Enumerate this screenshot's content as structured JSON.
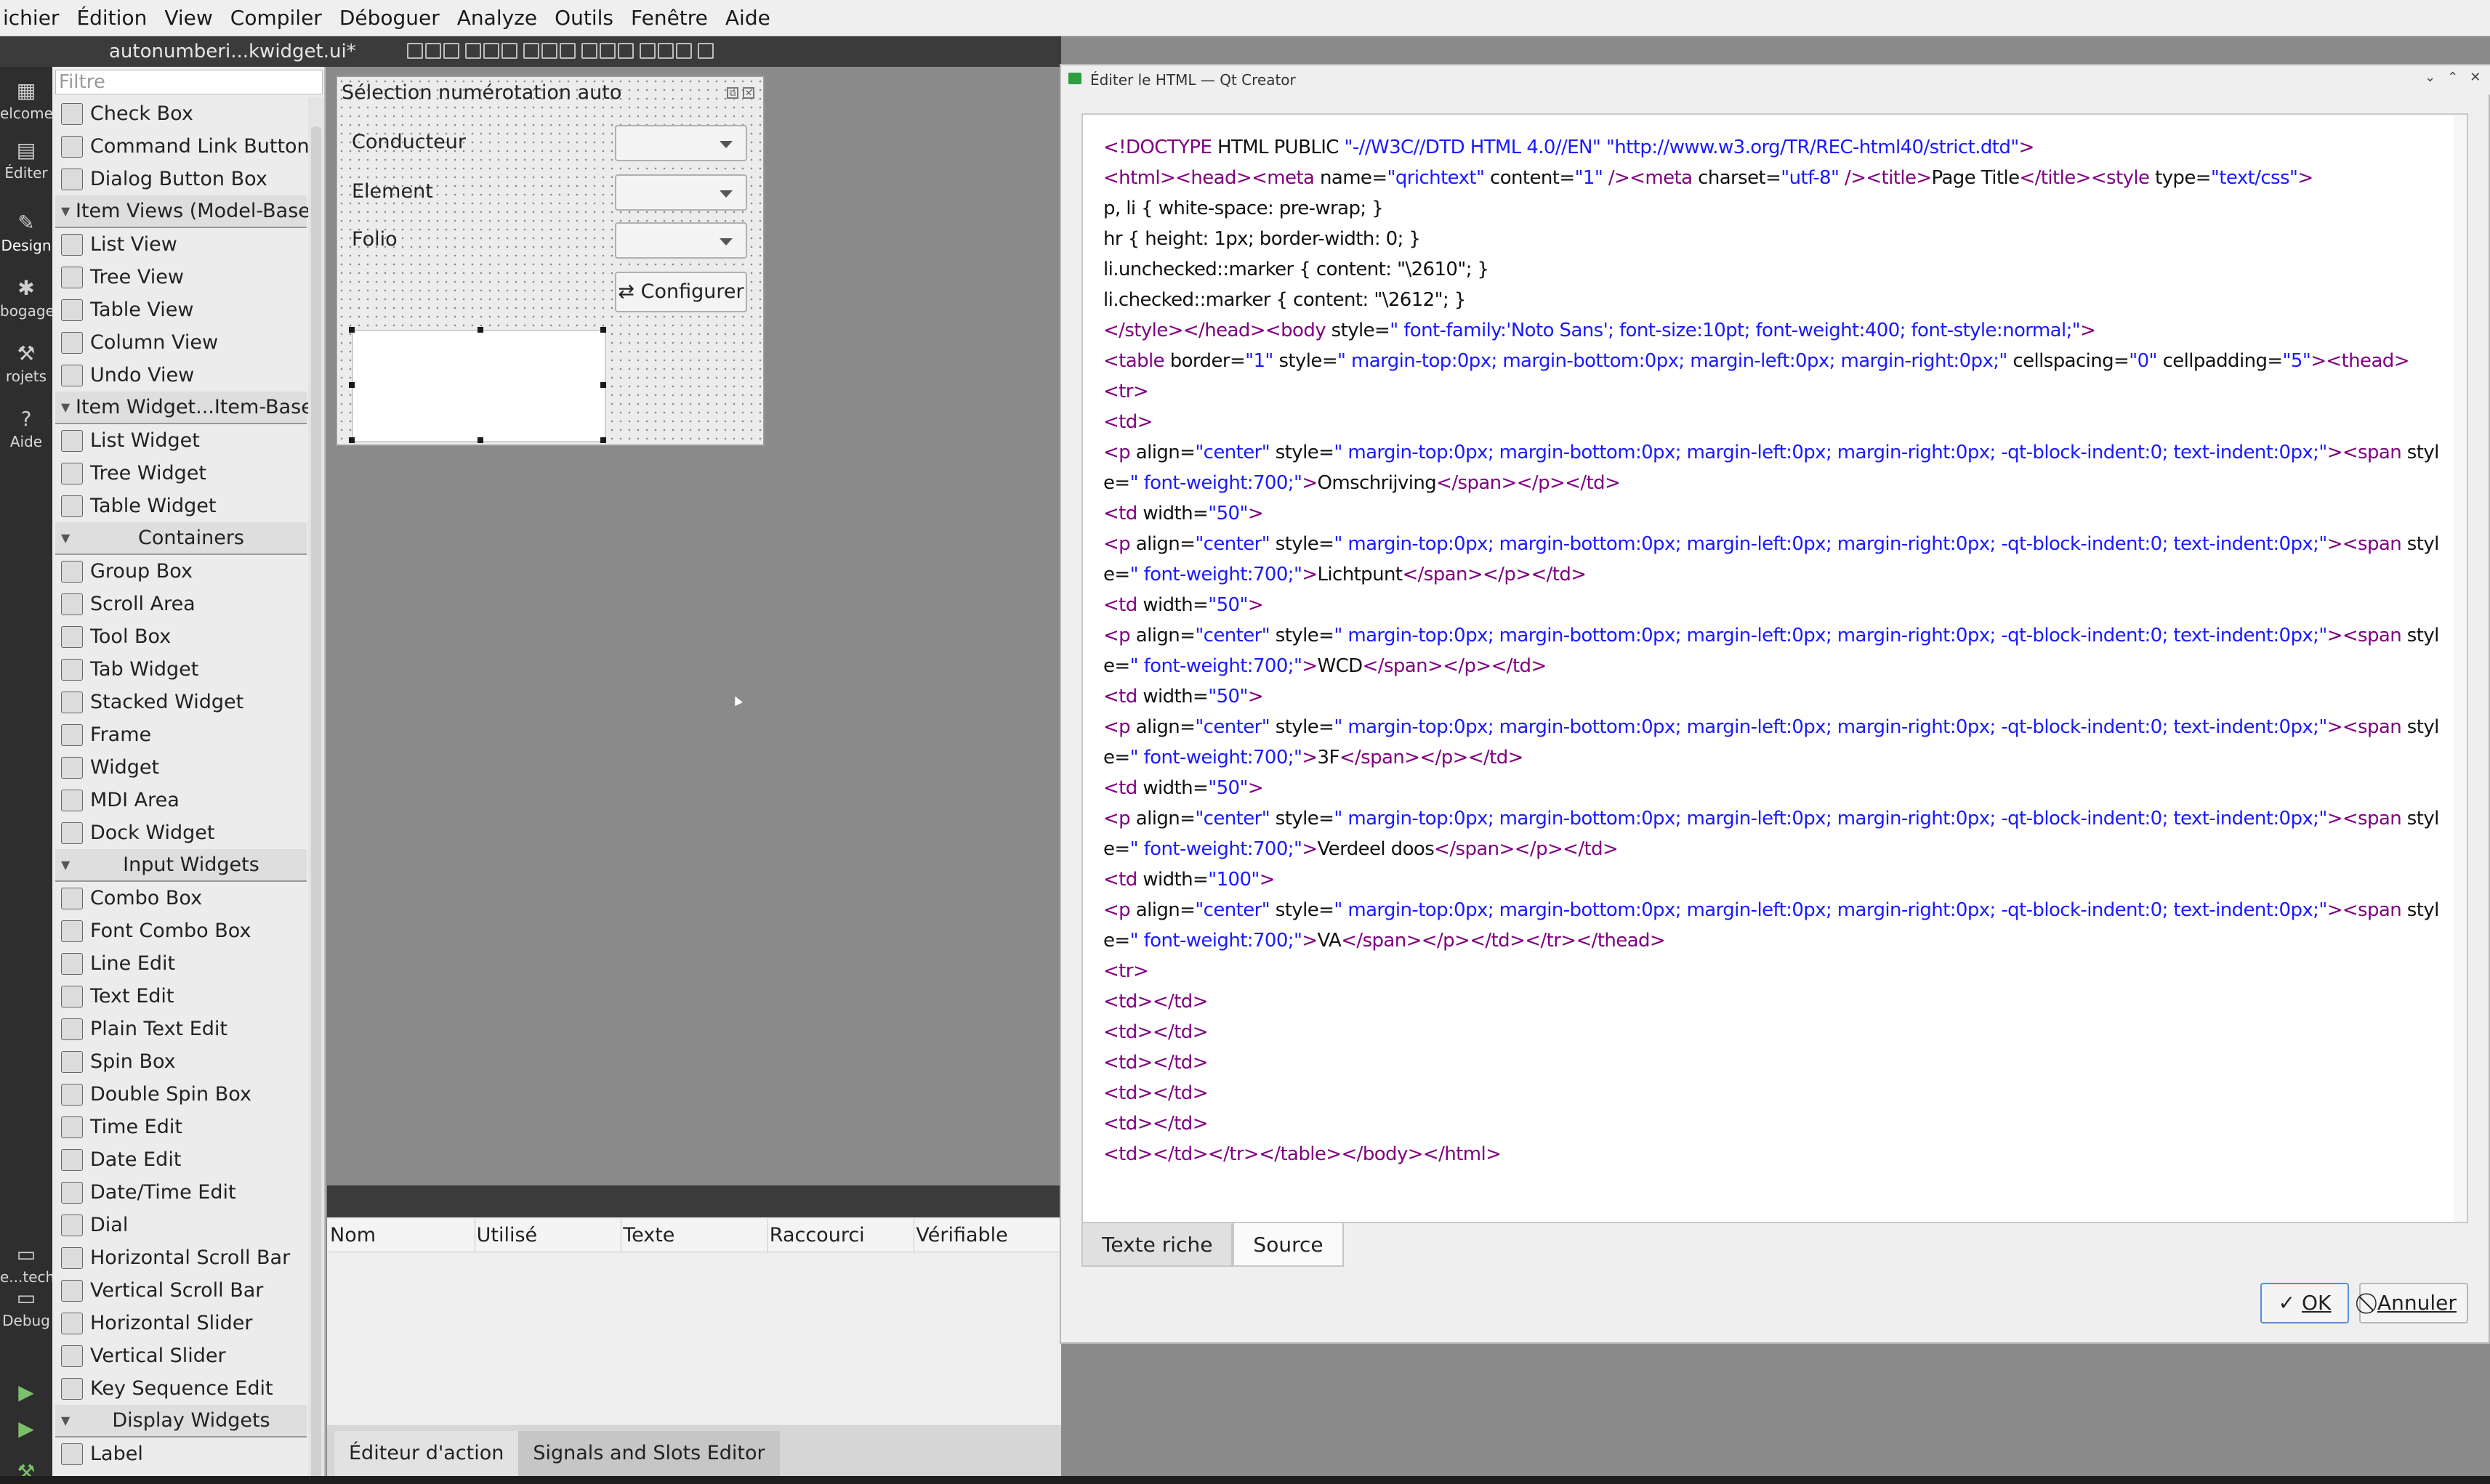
{
  "menubar": {
    "items": [
      "ichier",
      "Édition",
      "View",
      "Compiler",
      "Déboguer",
      "Analyze",
      "Outils",
      "Fenêtre",
      "Aide"
    ]
  },
  "doc_toolbar": {
    "file_name": "autonumberi...kwidget.ui*",
    "icons": [
      "layout-icon",
      "break-layout-icon",
      "grid-icon"
    ]
  },
  "modes": [
    {
      "label": "elcome",
      "icon": "grid-icon"
    },
    {
      "label": "Éditer",
      "icon": "edit-icon"
    },
    {
      "label": "Design",
      "icon": "pencil-icon"
    },
    {
      "label": "bogage",
      "icon": "bug-icon"
    },
    {
      "label": "rojets",
      "icon": "wrench-icon"
    },
    {
      "label": "Aide",
      "icon": "help-icon"
    },
    {
      "label": "e...tech",
      "icon": "monitor-icon"
    },
    {
      "label": "Debug",
      "icon": "monitor-icon"
    }
  ],
  "widgetbox": {
    "filter_placeholder": "Filtre",
    "entries": [
      {
        "type": "item",
        "label": "Check Box"
      },
      {
        "type": "item",
        "label": "Command Link Button"
      },
      {
        "type": "item",
        "label": "Dialog Button Box"
      },
      {
        "type": "cat",
        "label": "Item Views (Model-Based)",
        "center": false
      },
      {
        "type": "item",
        "label": "List View"
      },
      {
        "type": "item",
        "label": "Tree View"
      },
      {
        "type": "item",
        "label": "Table View"
      },
      {
        "type": "item",
        "label": "Column View"
      },
      {
        "type": "item",
        "label": "Undo View"
      },
      {
        "type": "cat",
        "label": "Item Widget...Item-Based)",
        "center": false
      },
      {
        "type": "item",
        "label": "List Widget"
      },
      {
        "type": "item",
        "label": "Tree Widget"
      },
      {
        "type": "item",
        "label": "Table Widget"
      },
      {
        "type": "cat",
        "label": "Containers",
        "center": true
      },
      {
        "type": "item",
        "label": "Group Box"
      },
      {
        "type": "item",
        "label": "Scroll Area"
      },
      {
        "type": "item",
        "label": "Tool Box"
      },
      {
        "type": "item",
        "label": "Tab Widget"
      },
      {
        "type": "item",
        "label": "Stacked Widget"
      },
      {
        "type": "item",
        "label": "Frame"
      },
      {
        "type": "item",
        "label": "Widget"
      },
      {
        "type": "item",
        "label": "MDI Area"
      },
      {
        "type": "item",
        "label": "Dock Widget"
      },
      {
        "type": "cat",
        "label": "Input Widgets",
        "center": true
      },
      {
        "type": "item",
        "label": "Combo Box"
      },
      {
        "type": "item",
        "label": "Font Combo Box"
      },
      {
        "type": "item",
        "label": "Line Edit"
      },
      {
        "type": "item",
        "label": "Text Edit"
      },
      {
        "type": "item",
        "label": "Plain Text Edit"
      },
      {
        "type": "item",
        "label": "Spin Box"
      },
      {
        "type": "item",
        "label": "Double Spin Box"
      },
      {
        "type": "item",
        "label": "Time Edit"
      },
      {
        "type": "item",
        "label": "Date Edit"
      },
      {
        "type": "item",
        "label": "Date/Time Edit"
      },
      {
        "type": "item",
        "label": "Dial"
      },
      {
        "type": "item",
        "label": "Horizontal Scroll Bar"
      },
      {
        "type": "item",
        "label": "Vertical Scroll Bar"
      },
      {
        "type": "item",
        "label": "Horizontal Slider"
      },
      {
        "type": "item",
        "label": "Vertical Slider"
      },
      {
        "type": "item",
        "label": "Key Sequence Edit"
      },
      {
        "type": "cat",
        "label": "Display Widgets",
        "center": true
      },
      {
        "type": "item",
        "label": "Label"
      }
    ]
  },
  "form": {
    "title": "Sélection numérotation auto",
    "labels": [
      "Conducteur",
      "Element",
      "Folio"
    ],
    "configure_button": "⇄ Configurer"
  },
  "action_editor": {
    "columns": [
      "Nom",
      "Utilisé",
      "Texte",
      "Raccourci",
      "Vérifiable"
    ],
    "tabs": [
      "Éditeur d'action",
      "Signals and Slots Editor"
    ]
  },
  "dialog": {
    "title": "Éditer le HTML — Qt Creator",
    "title_buttons": [
      "⌄",
      "⌃",
      "✕"
    ],
    "tabs": [
      "Texte riche",
      "Source"
    ],
    "ok_label": "OK",
    "cancel_label": "Annuler",
    "colors": {
      "tag": "#800080",
      "attr_value": "#1a1aff"
    },
    "code_lines": [
      [
        [
          "t",
          "<!DOCTYPE "
        ],
        [
          "a",
          "HTML PUBLIC "
        ],
        [
          "v",
          "\"-//W3C//DTD HTML 4.0//EN\" \"http://www.w3.org/TR/REC-html40/strict.dtd\""
        ],
        [
          "t",
          ">"
        ]
      ],
      [
        [
          "t",
          "<html><head><meta "
        ],
        [
          "a",
          "name"
        ],
        [
          "a",
          "="
        ],
        [
          "v",
          "\"qrichtext\" "
        ],
        [
          "a",
          "content"
        ],
        [
          "a",
          "="
        ],
        [
          "v",
          "\"1\" "
        ],
        [
          "t",
          "/><meta "
        ],
        [
          "a",
          "charset"
        ],
        [
          "a",
          "="
        ],
        [
          "v",
          "\"utf-8\" "
        ],
        [
          "t",
          "/><title>"
        ],
        [
          "a",
          "Page Title"
        ],
        [
          "t",
          "</title><style "
        ],
        [
          "a",
          "type"
        ],
        [
          "a",
          "="
        ],
        [
          "v",
          "\"text/css\""
        ],
        [
          "t",
          ">"
        ]
      ],
      [
        [
          "a",
          "p, li { white-space: pre-wrap; }"
        ]
      ],
      [
        [
          "a",
          "hr { height: 1px; border-width: 0; }"
        ]
      ],
      [
        [
          "a",
          "li.unchecked::marker { content: \"\\2610\"; }"
        ]
      ],
      [
        [
          "a",
          "li.checked::marker { content: \"\\2612\"; }"
        ]
      ],
      [
        [
          "t",
          "</style></head><body "
        ],
        [
          "a",
          "style"
        ],
        [
          "a",
          "="
        ],
        [
          "v",
          "\" font-family:'Noto Sans'; font-size:10pt; font-weight:400; font-style:normal;\""
        ],
        [
          "t",
          ">"
        ]
      ],
      [
        [
          "t",
          "<table "
        ],
        [
          "a",
          "border"
        ],
        [
          "a",
          "="
        ],
        [
          "v",
          "\"1\" "
        ],
        [
          "a",
          "style"
        ],
        [
          "a",
          "="
        ],
        [
          "v",
          "\" margin-top:0px; margin-bottom:0px; margin-left:0px; margin-right:0px;\" "
        ],
        [
          "a",
          "cellspacing"
        ],
        [
          "a",
          "="
        ],
        [
          "v",
          "\"0\" "
        ],
        [
          "a",
          "cellpadding"
        ],
        [
          "a",
          "="
        ],
        [
          "v",
          "\"5\""
        ],
        [
          "t",
          "><thead>"
        ]
      ],
      [
        [
          "t",
          "<tr>"
        ]
      ],
      [
        [
          "t",
          "<td>"
        ]
      ],
      [
        [
          "t",
          "<p "
        ],
        [
          "a",
          "align"
        ],
        [
          "a",
          "="
        ],
        [
          "v",
          "\"center\" "
        ],
        [
          "a",
          "style"
        ],
        [
          "a",
          "="
        ],
        [
          "v",
          "\" margin-top:0px; margin-bottom:0px; margin-left:0px; margin-right:0px; -qt-block-indent:0; text-indent:0px;\""
        ],
        [
          "t",
          "><span "
        ],
        [
          "a",
          "style"
        ],
        [
          "a",
          "="
        ],
        [
          "v",
          "\" font-weight:700;\""
        ],
        [
          "t",
          ">"
        ],
        [
          "a",
          "Omschrijving"
        ],
        [
          "t",
          "</span></p></td>"
        ]
      ],
      [
        [
          "t",
          "<td "
        ],
        [
          "a",
          "width"
        ],
        [
          "a",
          "="
        ],
        [
          "v",
          "\"50\""
        ],
        [
          "t",
          ">"
        ]
      ],
      [
        [
          "t",
          "<p "
        ],
        [
          "a",
          "align"
        ],
        [
          "a",
          "="
        ],
        [
          "v",
          "\"center\" "
        ],
        [
          "a",
          "style"
        ],
        [
          "a",
          "="
        ],
        [
          "v",
          "\" margin-top:0px; margin-bottom:0px; margin-left:0px; margin-right:0px; -qt-block-indent:0; text-indent:0px;\""
        ],
        [
          "t",
          "><span "
        ],
        [
          "a",
          "style"
        ],
        [
          "a",
          "="
        ],
        [
          "v",
          "\" font-weight:700;\""
        ],
        [
          "t",
          ">"
        ],
        [
          "a",
          "Lichtpunt"
        ],
        [
          "t",
          "</span></p></td>"
        ]
      ],
      [
        [
          "t",
          "<td "
        ],
        [
          "a",
          "width"
        ],
        [
          "a",
          "="
        ],
        [
          "v",
          "\"50\""
        ],
        [
          "t",
          ">"
        ]
      ],
      [
        [
          "t",
          "<p "
        ],
        [
          "a",
          "align"
        ],
        [
          "a",
          "="
        ],
        [
          "v",
          "\"center\" "
        ],
        [
          "a",
          "style"
        ],
        [
          "a",
          "="
        ],
        [
          "v",
          "\" margin-top:0px; margin-bottom:0px; margin-left:0px; margin-right:0px; -qt-block-indent:0; text-indent:0px;\""
        ],
        [
          "t",
          "><span "
        ],
        [
          "a",
          "style"
        ],
        [
          "a",
          "="
        ],
        [
          "v",
          "\" font-weight:700;\""
        ],
        [
          "t",
          ">"
        ],
        [
          "a",
          "WCD"
        ],
        [
          "t",
          "</span></p></td>"
        ]
      ],
      [
        [
          "t",
          "<td "
        ],
        [
          "a",
          "width"
        ],
        [
          "a",
          "="
        ],
        [
          "v",
          "\"50\""
        ],
        [
          "t",
          ">"
        ]
      ],
      [
        [
          "t",
          "<p "
        ],
        [
          "a",
          "align"
        ],
        [
          "a",
          "="
        ],
        [
          "v",
          "\"center\" "
        ],
        [
          "a",
          "style"
        ],
        [
          "a",
          "="
        ],
        [
          "v",
          "\" margin-top:0px; margin-bottom:0px; margin-left:0px; margin-right:0px; -qt-block-indent:0; text-indent:0px;\""
        ],
        [
          "t",
          "><span "
        ],
        [
          "a",
          "style"
        ],
        [
          "a",
          "="
        ],
        [
          "v",
          "\" font-weight:700;\""
        ],
        [
          "t",
          ">"
        ],
        [
          "a",
          "3F"
        ],
        [
          "t",
          "</span></p></td>"
        ]
      ],
      [
        [
          "t",
          "<td "
        ],
        [
          "a",
          "width"
        ],
        [
          "a",
          "="
        ],
        [
          "v",
          "\"50\""
        ],
        [
          "t",
          ">"
        ]
      ],
      [
        [
          "t",
          "<p "
        ],
        [
          "a",
          "align"
        ],
        [
          "a",
          "="
        ],
        [
          "v",
          "\"center\" "
        ],
        [
          "a",
          "style"
        ],
        [
          "a",
          "="
        ],
        [
          "v",
          "\" margin-top:0px; margin-bottom:0px; margin-left:0px; margin-right:0px; -qt-block-indent:0; text-indent:0px;\""
        ],
        [
          "t",
          "><span "
        ],
        [
          "a",
          "style"
        ],
        [
          "a",
          "="
        ],
        [
          "v",
          "\" font-weight:700;\""
        ],
        [
          "t",
          ">"
        ],
        [
          "a",
          "Verdeel doos"
        ],
        [
          "t",
          "</span></p></td>"
        ]
      ],
      [
        [
          "t",
          "<td "
        ],
        [
          "a",
          "width"
        ],
        [
          "a",
          "="
        ],
        [
          "v",
          "\"100\""
        ],
        [
          "t",
          ">"
        ]
      ],
      [
        [
          "t",
          "<p "
        ],
        [
          "a",
          "align"
        ],
        [
          "a",
          "="
        ],
        [
          "v",
          "\"center\" "
        ],
        [
          "a",
          "style"
        ],
        [
          "a",
          "="
        ],
        [
          "v",
          "\" margin-top:0px; margin-bottom:0px; margin-left:0px; margin-right:0px; -qt-block-indent:0; text-indent:0px;\""
        ],
        [
          "t",
          "><span "
        ],
        [
          "a",
          "style"
        ],
        [
          "a",
          "="
        ],
        [
          "v",
          "\" font-weight:700;\""
        ],
        [
          "t",
          ">"
        ],
        [
          "a",
          "VA"
        ],
        [
          "t",
          "</span></p></td></tr></thead>"
        ]
      ],
      [
        [
          "t",
          "<tr>"
        ]
      ],
      [
        [
          "t",
          "<td></td>"
        ]
      ],
      [
        [
          "t",
          "<td></td>"
        ]
      ],
      [
        [
          "t",
          "<td></td>"
        ]
      ],
      [
        [
          "t",
          "<td></td>"
        ]
      ],
      [
        [
          "t",
          "<td></td>"
        ]
      ],
      [
        [
          "t",
          "<td></td></tr></table></body></html>"
        ]
      ]
    ]
  }
}
